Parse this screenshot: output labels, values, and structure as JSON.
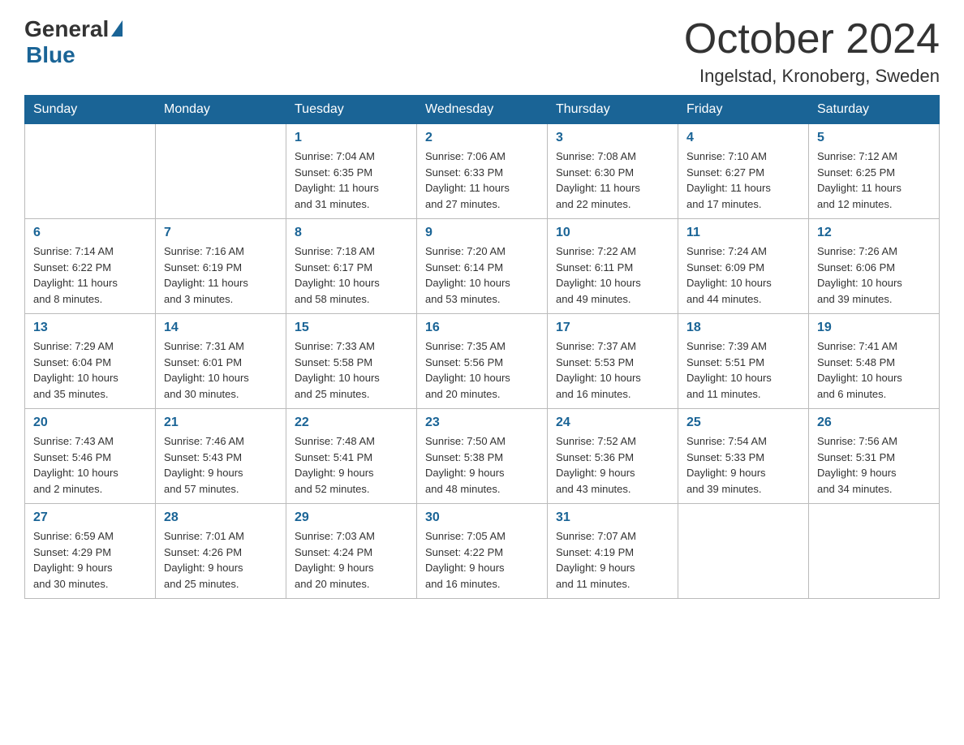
{
  "logo": {
    "general": "General",
    "blue": "Blue"
  },
  "title": "October 2024",
  "location": "Ingelstad, Kronoberg, Sweden",
  "days_of_week": [
    "Sunday",
    "Monday",
    "Tuesday",
    "Wednesday",
    "Thursday",
    "Friday",
    "Saturday"
  ],
  "weeks": [
    [
      {
        "day": "",
        "info": ""
      },
      {
        "day": "",
        "info": ""
      },
      {
        "day": "1",
        "info": "Sunrise: 7:04 AM\nSunset: 6:35 PM\nDaylight: 11 hours\nand 31 minutes."
      },
      {
        "day": "2",
        "info": "Sunrise: 7:06 AM\nSunset: 6:33 PM\nDaylight: 11 hours\nand 27 minutes."
      },
      {
        "day": "3",
        "info": "Sunrise: 7:08 AM\nSunset: 6:30 PM\nDaylight: 11 hours\nand 22 minutes."
      },
      {
        "day": "4",
        "info": "Sunrise: 7:10 AM\nSunset: 6:27 PM\nDaylight: 11 hours\nand 17 minutes."
      },
      {
        "day": "5",
        "info": "Sunrise: 7:12 AM\nSunset: 6:25 PM\nDaylight: 11 hours\nand 12 minutes."
      }
    ],
    [
      {
        "day": "6",
        "info": "Sunrise: 7:14 AM\nSunset: 6:22 PM\nDaylight: 11 hours\nand 8 minutes."
      },
      {
        "day": "7",
        "info": "Sunrise: 7:16 AM\nSunset: 6:19 PM\nDaylight: 11 hours\nand 3 minutes."
      },
      {
        "day": "8",
        "info": "Sunrise: 7:18 AM\nSunset: 6:17 PM\nDaylight: 10 hours\nand 58 minutes."
      },
      {
        "day": "9",
        "info": "Sunrise: 7:20 AM\nSunset: 6:14 PM\nDaylight: 10 hours\nand 53 minutes."
      },
      {
        "day": "10",
        "info": "Sunrise: 7:22 AM\nSunset: 6:11 PM\nDaylight: 10 hours\nand 49 minutes."
      },
      {
        "day": "11",
        "info": "Sunrise: 7:24 AM\nSunset: 6:09 PM\nDaylight: 10 hours\nand 44 minutes."
      },
      {
        "day": "12",
        "info": "Sunrise: 7:26 AM\nSunset: 6:06 PM\nDaylight: 10 hours\nand 39 minutes."
      }
    ],
    [
      {
        "day": "13",
        "info": "Sunrise: 7:29 AM\nSunset: 6:04 PM\nDaylight: 10 hours\nand 35 minutes."
      },
      {
        "day": "14",
        "info": "Sunrise: 7:31 AM\nSunset: 6:01 PM\nDaylight: 10 hours\nand 30 minutes."
      },
      {
        "day": "15",
        "info": "Sunrise: 7:33 AM\nSunset: 5:58 PM\nDaylight: 10 hours\nand 25 minutes."
      },
      {
        "day": "16",
        "info": "Sunrise: 7:35 AM\nSunset: 5:56 PM\nDaylight: 10 hours\nand 20 minutes."
      },
      {
        "day": "17",
        "info": "Sunrise: 7:37 AM\nSunset: 5:53 PM\nDaylight: 10 hours\nand 16 minutes."
      },
      {
        "day": "18",
        "info": "Sunrise: 7:39 AM\nSunset: 5:51 PM\nDaylight: 10 hours\nand 11 minutes."
      },
      {
        "day": "19",
        "info": "Sunrise: 7:41 AM\nSunset: 5:48 PM\nDaylight: 10 hours\nand 6 minutes."
      }
    ],
    [
      {
        "day": "20",
        "info": "Sunrise: 7:43 AM\nSunset: 5:46 PM\nDaylight: 10 hours\nand 2 minutes."
      },
      {
        "day": "21",
        "info": "Sunrise: 7:46 AM\nSunset: 5:43 PM\nDaylight: 9 hours\nand 57 minutes."
      },
      {
        "day": "22",
        "info": "Sunrise: 7:48 AM\nSunset: 5:41 PM\nDaylight: 9 hours\nand 52 minutes."
      },
      {
        "day": "23",
        "info": "Sunrise: 7:50 AM\nSunset: 5:38 PM\nDaylight: 9 hours\nand 48 minutes."
      },
      {
        "day": "24",
        "info": "Sunrise: 7:52 AM\nSunset: 5:36 PM\nDaylight: 9 hours\nand 43 minutes."
      },
      {
        "day": "25",
        "info": "Sunrise: 7:54 AM\nSunset: 5:33 PM\nDaylight: 9 hours\nand 39 minutes."
      },
      {
        "day": "26",
        "info": "Sunrise: 7:56 AM\nSunset: 5:31 PM\nDaylight: 9 hours\nand 34 minutes."
      }
    ],
    [
      {
        "day": "27",
        "info": "Sunrise: 6:59 AM\nSunset: 4:29 PM\nDaylight: 9 hours\nand 30 minutes."
      },
      {
        "day": "28",
        "info": "Sunrise: 7:01 AM\nSunset: 4:26 PM\nDaylight: 9 hours\nand 25 minutes."
      },
      {
        "day": "29",
        "info": "Sunrise: 7:03 AM\nSunset: 4:24 PM\nDaylight: 9 hours\nand 20 minutes."
      },
      {
        "day": "30",
        "info": "Sunrise: 7:05 AM\nSunset: 4:22 PM\nDaylight: 9 hours\nand 16 minutes."
      },
      {
        "day": "31",
        "info": "Sunrise: 7:07 AM\nSunset: 4:19 PM\nDaylight: 9 hours\nand 11 minutes."
      },
      {
        "day": "",
        "info": ""
      },
      {
        "day": "",
        "info": ""
      }
    ]
  ]
}
